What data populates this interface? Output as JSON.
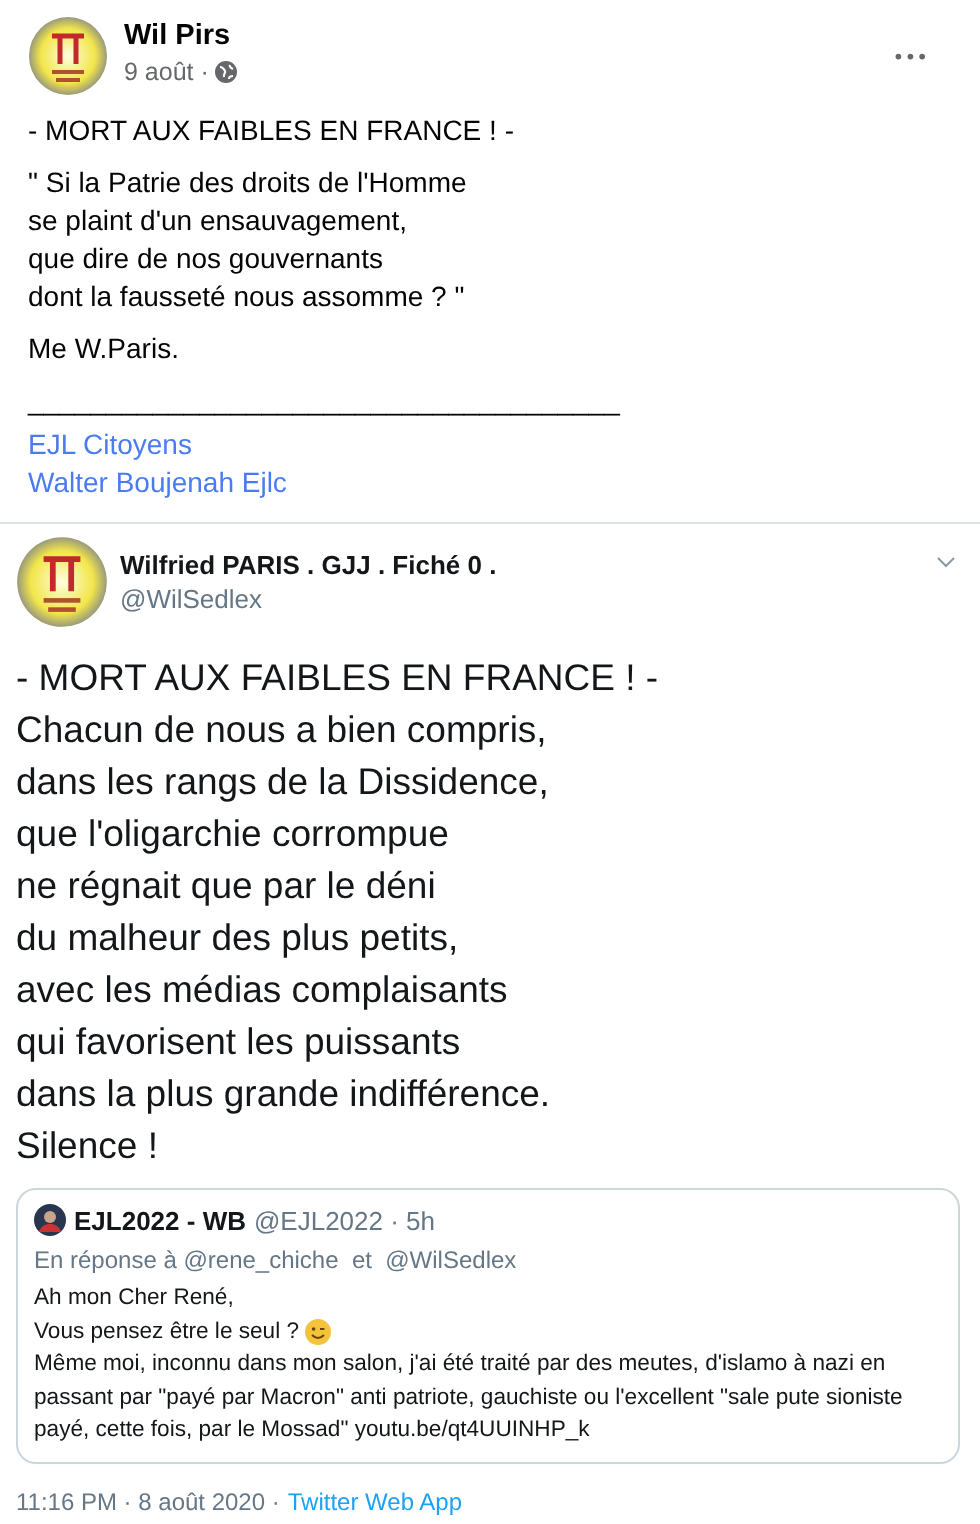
{
  "post": {
    "author": "Wil Pirs",
    "date": "9 août ·",
    "more": "•••",
    "paragraphs": [
      "- MORT AUX FAIBLES EN FRANCE ! -",
      "\" Si la Patrie des droits de l'Homme\nse plaint d'un ensauvagement,\nque dire de nos gouvernants\ndont la fausseté nous assomme ? \"",
      "Me W.Paris.",
      "______________________________________"
    ],
    "links": [
      "EJL Citoyens",
      "Walter Boujenah Ejlc"
    ]
  },
  "tweet": {
    "name": "Wilfried PARIS . GJJ . Fiché 0 .",
    "handle": "@WilSedlex",
    "lines": [
      "- MORT AUX FAIBLES EN FRANCE ! -",
      "Chacun de nous a bien compris,",
      "dans les rangs de la Dissidence,",
      "que l'oligarchie corrompue",
      "ne régnait que par le déni",
      "du malheur des plus petits,",
      "avec les médias complaisants",
      "qui favorisent les puissants",
      "dans la plus grande indifférence.",
      "Silence !"
    ],
    "quote": {
      "name": "EJL2022 - WB",
      "meta": "@EJL2022 · 5h",
      "reply_to": "En réponse à @rene_chiche  et  @WilSedlex",
      "lines": [
        "Ah mon Cher René,",
        "Vous pensez être le seul ?",
        "Même moi, inconnu dans mon salon, j'ai été traité par des meutes, d'islamo à nazi en passant par \"payé par Macron\" anti patriote, gauchiste ou l'excellent \"sale pute sioniste payé, cette fois, par le Mossad\" youtu.be/qt4UUINHP_k"
      ]
    },
    "time": "11:16 PM · 8 août 2020 ·",
    "source": "Twitter Web App"
  }
}
